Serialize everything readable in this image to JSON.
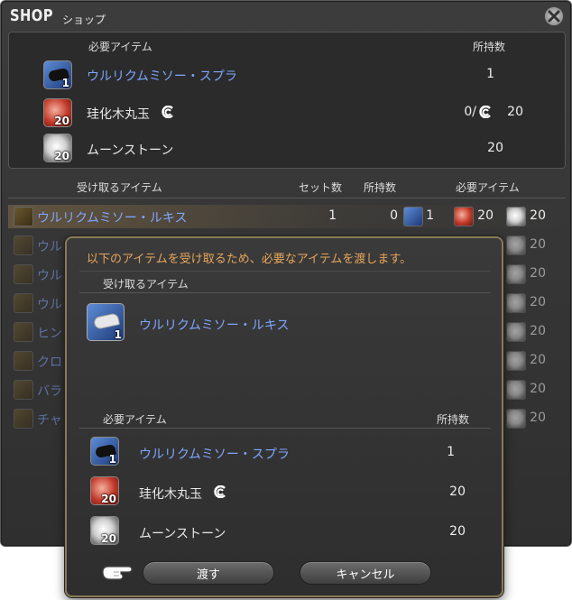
{
  "shop": {
    "title": "SHOP",
    "subtitle": "ショップ",
    "required_header": "必要アイテム",
    "owned_header": "所持数",
    "required_items": [
      {
        "name": "ウルリクムミソー・スプラ",
        "icon_qty": "1",
        "owned": "1",
        "icon": "weapon-icon",
        "name_color": "#7fa6ff"
      },
      {
        "name": "珪化木丸玉",
        "icon_qty": "20",
        "owned": "0/",
        "owned_extra": "20",
        "icon": "red-gem-icon"
      },
      {
        "name": "ムーンストーン",
        "icon_qty": "20",
        "owned": "20",
        "icon": "moonstone-icon"
      }
    ],
    "list_headers": {
      "receive": "受け取るアイテム",
      "set_count": "セット数",
      "owned": "所持数",
      "required": "必要アイテム"
    },
    "list_items": [
      {
        "name": "ウルリクムミソー・ルキス",
        "set_count": "1",
        "owned": "0",
        "req1": "1",
        "req2": "20",
        "req3": "20"
      },
      {
        "name": "ウル",
        "req3": "20"
      },
      {
        "name": "ウル",
        "req3": "20"
      },
      {
        "name": "ウル",
        "req3": "20"
      },
      {
        "name": "ヒン",
        "req3": "20"
      },
      {
        "name": "クロ",
        "req3": "20"
      },
      {
        "name": "バラ",
        "req3": "20"
      },
      {
        "name": "チャ",
        "req3": "20"
      }
    ]
  },
  "dialog": {
    "message": "以下のアイテムを受け取るため、必要なアイテムを渡します。",
    "receive_header": "受け取るアイテム",
    "receive_item": {
      "name": "ウルリクムミソー・ルキス",
      "icon_qty": "1"
    },
    "required_header": "必要アイテム",
    "owned_header": "所持数",
    "required_items": [
      {
        "name": "ウルリクムミソー・スプラ",
        "icon_qty": "1",
        "owned": "1"
      },
      {
        "name": "珪化木丸玉",
        "icon_qty": "20",
        "owned": "20"
      },
      {
        "name": "ムーンストーン",
        "icon_qty": "20",
        "owned": "20"
      }
    ],
    "confirm_label": "渡す",
    "cancel_label": "キャンセル"
  }
}
